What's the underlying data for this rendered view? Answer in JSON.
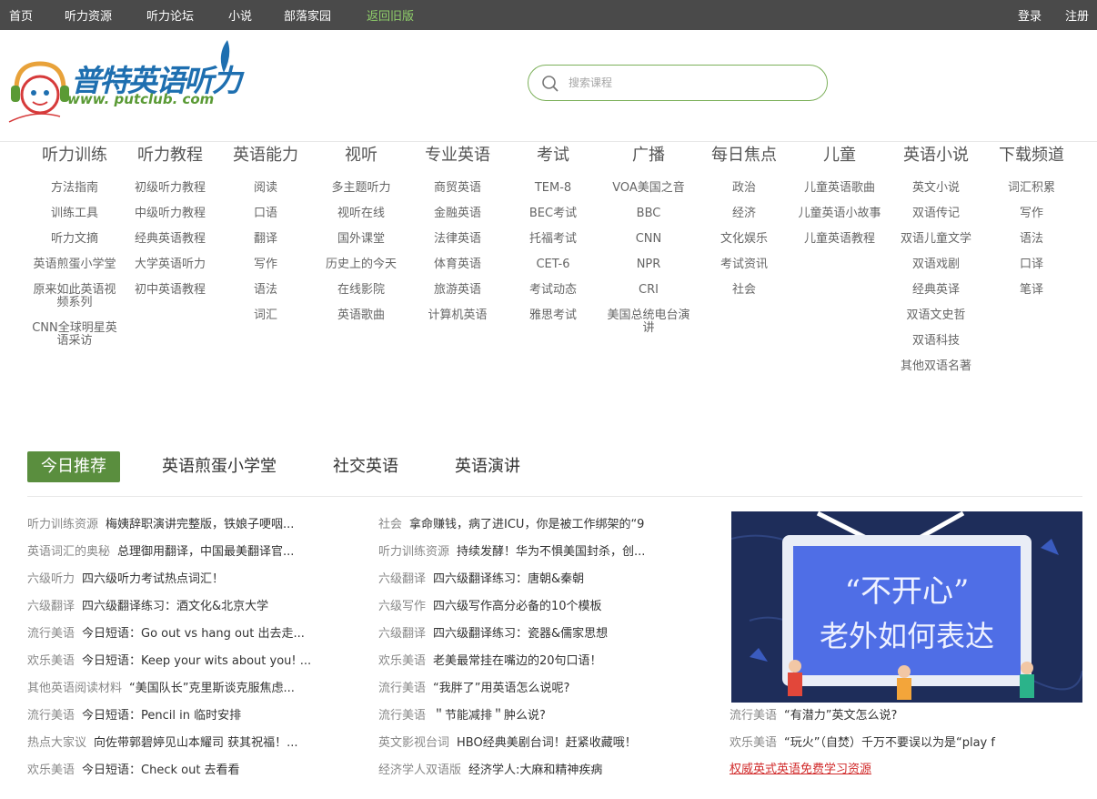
{
  "topnav": {
    "items": [
      {
        "label": "首页"
      },
      {
        "label": "听力资源"
      },
      {
        "label": "听力论坛"
      },
      {
        "label": "小说"
      },
      {
        "label": "部落家园"
      },
      {
        "label": "返回旧版"
      }
    ],
    "login": "登录",
    "register": "注册"
  },
  "logo": {
    "wordmark": "普特英语听力",
    "url": "www. putclub. com"
  },
  "search": {
    "placeholder": "搜索课程",
    "value": ""
  },
  "categories": [
    {
      "title": "听力训练",
      "items": [
        "方法指南",
        "训练工具",
        "听力文摘",
        "英语煎蛋小学堂",
        "原来如此英语视频系列",
        "CNN全球明星英语采访"
      ]
    },
    {
      "title": "听力教程",
      "items": [
        "初级听力教程",
        "中级听力教程",
        "经典英语教程",
        "大学英语听力",
        "初中英语教程"
      ]
    },
    {
      "title": "英语能力",
      "items": [
        "阅读",
        "口语",
        "翻译",
        "写作",
        "语法",
        "词汇"
      ]
    },
    {
      "title": "视听",
      "items": [
        "多主题听力",
        "视听在线",
        "国外课堂",
        "历史上的今天",
        "在线影院",
        "英语歌曲"
      ]
    },
    {
      "title": "专业英语",
      "items": [
        "商贸英语",
        "金融英语",
        "法律英语",
        "体育英语",
        "旅游英语",
        "计算机英语"
      ]
    },
    {
      "title": "考试",
      "items": [
        "TEM-8",
        "BEC考试",
        "托福考试",
        "CET-6",
        "考试动态",
        "雅思考试"
      ]
    },
    {
      "title": "广播",
      "items": [
        "VOA美国之音",
        "BBC",
        "CNN",
        "NPR",
        "CRI",
        "美国总统电台演讲"
      ]
    },
    {
      "title": "每日焦点",
      "items": [
        "政治",
        "经济",
        "文化娱乐",
        "考试资讯",
        "社会"
      ]
    },
    {
      "title": "儿童",
      "items": [
        "儿童英语歌曲",
        "儿童英语小故事",
        "儿童英语教程"
      ]
    },
    {
      "title": "英语小说",
      "items": [
        "英文小说",
        "双语传记",
        "双语儿童文学",
        "双语戏剧",
        "经典英译",
        "双语文史哲",
        "双语科技",
        "其他双语名著"
      ]
    },
    {
      "title": "下载频道",
      "items": [
        "词汇积累",
        "写作",
        "语法",
        "口译",
        "笔译"
      ]
    }
  ],
  "tabs": [
    {
      "label": "今日推荐"
    },
    {
      "label": "英语煎蛋小学堂"
    },
    {
      "label": "社交英语"
    },
    {
      "label": "英语演讲"
    }
  ],
  "news_left": [
    {
      "cat": "听力训练资源",
      "title": "梅姨辞职演讲完整版，铁娘子哽咽..."
    },
    {
      "cat": "英语词汇的奥秘",
      "title": "总理御用翻译，中国最美翻译官..."
    },
    {
      "cat": "六级听力",
      "title": "四六级听力考试热点词汇！"
    },
    {
      "cat": "六级翻译",
      "title": "四六级翻译练习：酒文化&北京大学"
    },
    {
      "cat": "流行美语",
      "title": "今日短语：Go out vs hang out 出去走..."
    },
    {
      "cat": "欢乐美语",
      "title": "今日短语：Keep your wits about you! ..."
    },
    {
      "cat": "其他英语阅读材料",
      "title": "“美国队长”克里斯谈克服焦虑..."
    },
    {
      "cat": "流行美语",
      "title": "今日短语：Pencil in 临时安排"
    },
    {
      "cat": "热点大家议",
      "title": "向佐带郭碧婷见山本耀司 获其祝福！..."
    },
    {
      "cat": "欢乐美语",
      "title": "今日短语：Check out 去看看"
    }
  ],
  "news_mid": [
    {
      "cat": "社会",
      "title": "拿命赚钱，病了进ICU，你是被工作绑架的“9"
    },
    {
      "cat": "听力训练资源",
      "title": "持续发酵！华为不惧美国封杀，创..."
    },
    {
      "cat": "六级翻译",
      "title": "四六级翻译练习：唐朝&秦朝"
    },
    {
      "cat": "六级写作",
      "title": "四六级写作高分必备的10个模板"
    },
    {
      "cat": "六级翻译",
      "title": "四六级翻译练习：瓷器&儒家思想"
    },
    {
      "cat": "欢乐美语",
      "title": "老美最常挂在嘴边的20句口语！"
    },
    {
      "cat": "流行美语",
      "title": "“我胖了”用英语怎么说呢?"
    },
    {
      "cat": "流行美语",
      "title": "＂节能减排＂肿么说?"
    },
    {
      "cat": "英文影视台词",
      "title": "HBO经典美剧台词！赶紧收藏哦！"
    },
    {
      "cat": "经济学人双语版",
      "title": "经济学人:大麻和精神疾病"
    }
  ],
  "promo": {
    "line1": "“不开心”",
    "line2": "老外如何表达"
  },
  "news_right": [
    {
      "cat": "流行美语",
      "title": "“有潜力”英文怎么说?"
    },
    {
      "cat": "欢乐美语",
      "title": "“玩火”（自焚）千万不要误以为是“play f"
    }
  ],
  "promo_link": "权威英式英语免费学习资源",
  "colors": {
    "topbar": "#4a4a4a",
    "accent_green": "#5a8e3e",
    "logo_blue": "#1e6fb0",
    "link_red": "#d12b2b"
  }
}
